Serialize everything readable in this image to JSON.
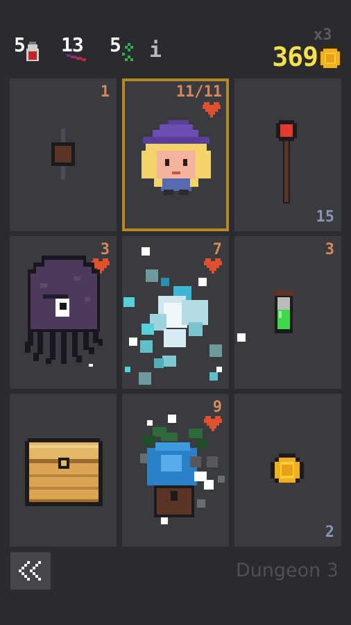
{
  "hud": {
    "potions": "5",
    "magic": "13",
    "xp": "5",
    "info_label": "i",
    "gold_multiplier": "x3",
    "gold": "369"
  },
  "cells": [
    {
      "id": "weapon-mace",
      "top_value": "1"
    },
    {
      "id": "hero-wizard",
      "top_value": "11/11"
    },
    {
      "id": "staff",
      "bottom_value": "15"
    },
    {
      "id": "monster-octopus",
      "top_value": "3"
    },
    {
      "id": "monster-ice-spirit",
      "top_value": "7"
    },
    {
      "id": "potion-green",
      "top_value": "3"
    },
    {
      "id": "treasure-chest"
    },
    {
      "id": "monster-ent",
      "top_value": "9"
    },
    {
      "id": "gold-coin",
      "bottom_value": "2"
    }
  ],
  "footer": {
    "back_icon": "double-chevron-left-icon",
    "dungeon_label": "Dungeon 3"
  },
  "colors": {
    "background": "#2a2b2e",
    "cell": "#3a3b3f",
    "selected_border": "#b8891f",
    "health_heart": "#e0502d",
    "gold": "#f6e04c"
  }
}
